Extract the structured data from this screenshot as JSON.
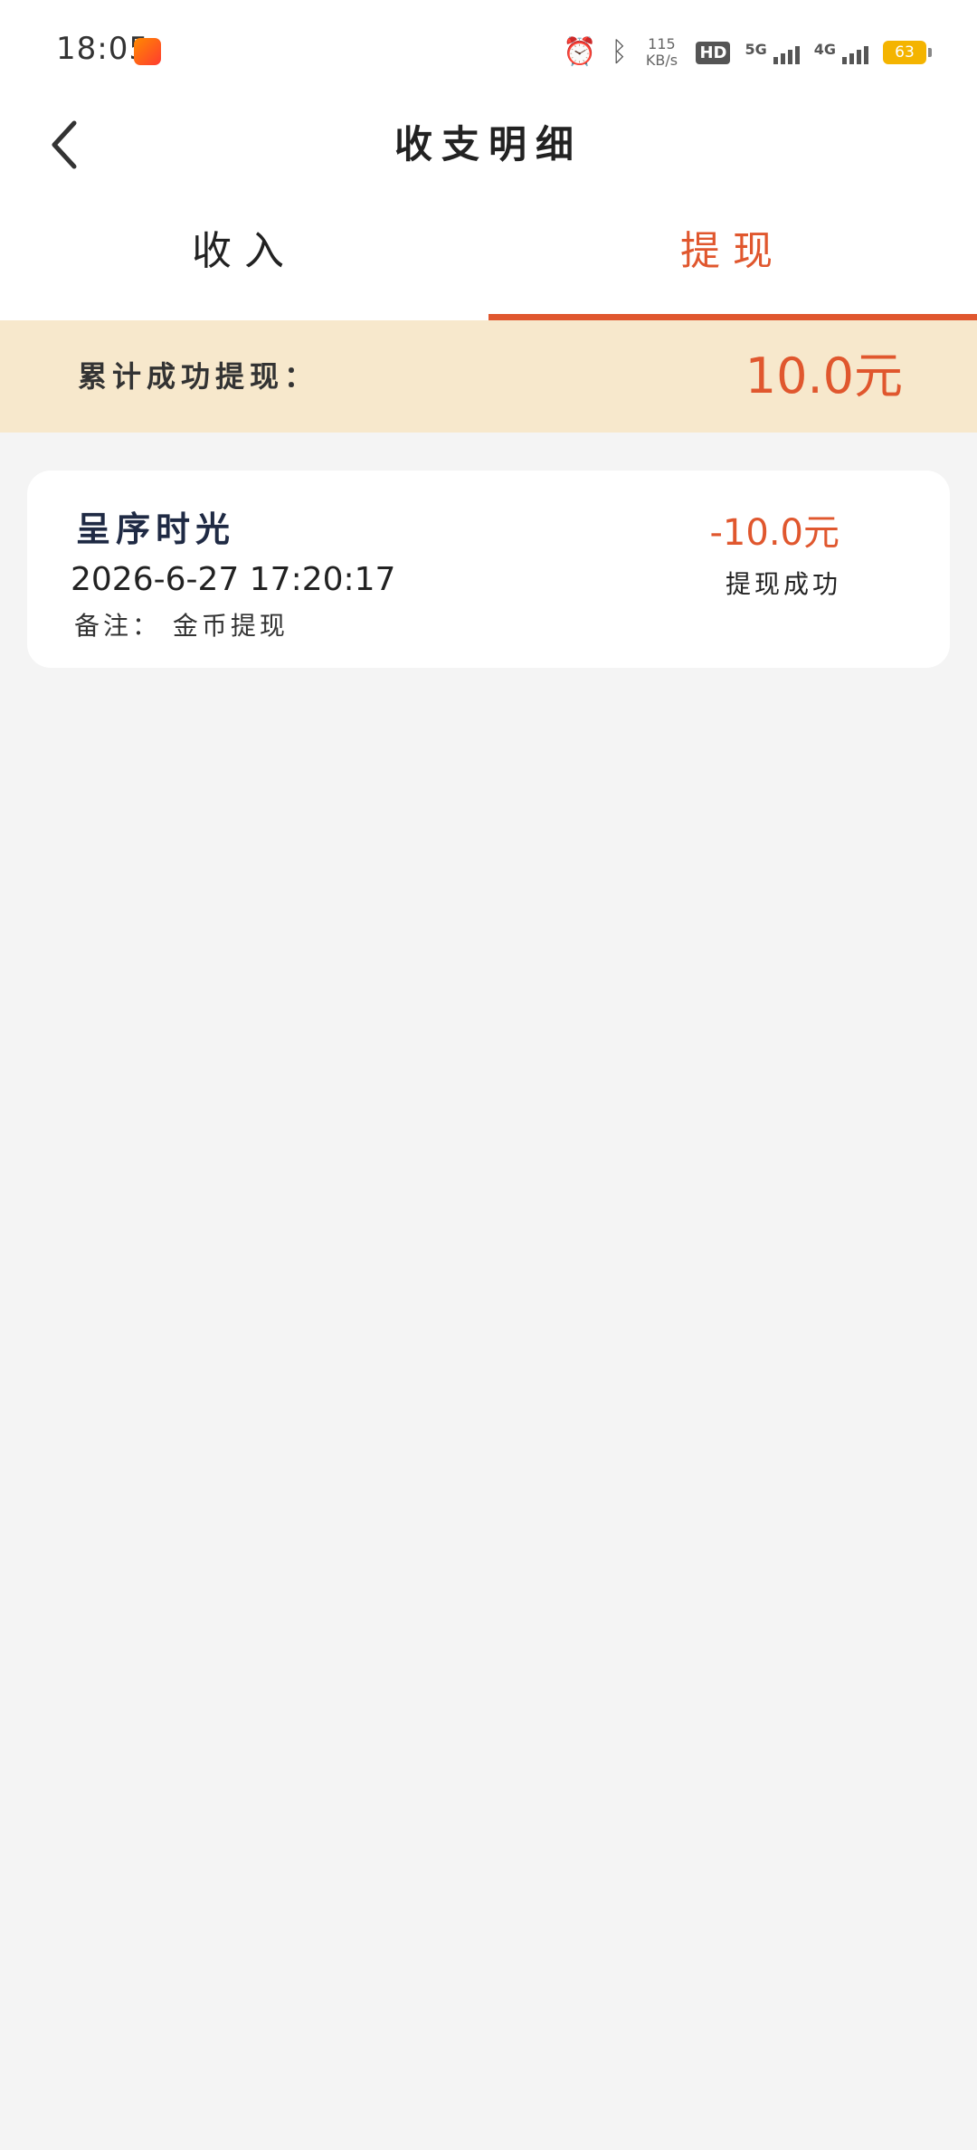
{
  "status_bar": {
    "time": "18:05",
    "net_speed_value": "115",
    "net_speed_unit": "KB/s",
    "hd_label": "HD",
    "sim1_label": "5G",
    "sim2_label": "4G",
    "battery": "63"
  },
  "header": {
    "title": "收支明细"
  },
  "tabs": [
    {
      "label": "收入",
      "active": false
    },
    {
      "label": "提现",
      "active": true
    }
  ],
  "summary": {
    "label": "累计成功提现：",
    "value": "10.0元"
  },
  "records": [
    {
      "name": "呈序时光",
      "datetime": "2026-6-27 17:20:17",
      "note": "备注： 金币提现",
      "amount": "-10.0元",
      "status": "提现成功"
    }
  ],
  "colors": {
    "accent": "#e0572e",
    "banner_bg": "#f7e8cc",
    "page_bg": "#f4f4f4"
  }
}
